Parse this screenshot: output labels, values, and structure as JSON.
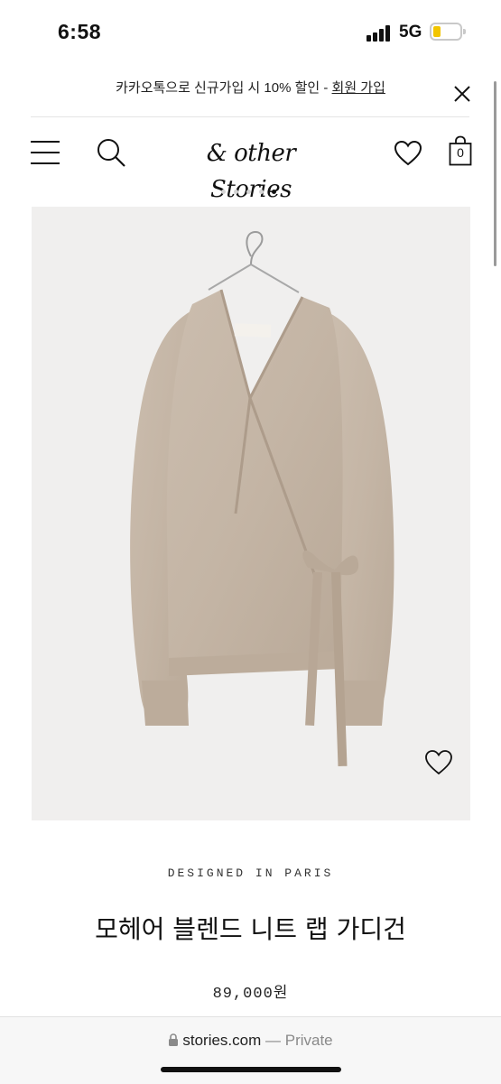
{
  "status_bar": {
    "time": "6:58",
    "network": "5G",
    "battery_level": 0.2,
    "battery_color": "#f2c500"
  },
  "promo": {
    "text": "카카오톡으로 신규가입 시 10% 할인 - ",
    "link_label": "회원 가입",
    "close_icon": "close-icon"
  },
  "header": {
    "menu_icon": "hamburger-menu-icon",
    "search_icon": "search-icon",
    "logo_text": "& other Stories",
    "wishlist_icon": "heart-icon",
    "cart_icon": "shopping-bag-icon",
    "cart_count": "0"
  },
  "carousel": {
    "total": 5,
    "active_index": 4
  },
  "product": {
    "image_alt": "beige mohair wrap cardigan on hanger",
    "designed_in": "DESIGNED IN PARIS",
    "name": "모헤어 블렌드 니트 랩 가디건",
    "price": "89,000원",
    "wishlist_icon": "heart-icon"
  },
  "browser": {
    "lock_icon": "lock-icon",
    "domain": "stories.com",
    "privacy": " — Private"
  }
}
